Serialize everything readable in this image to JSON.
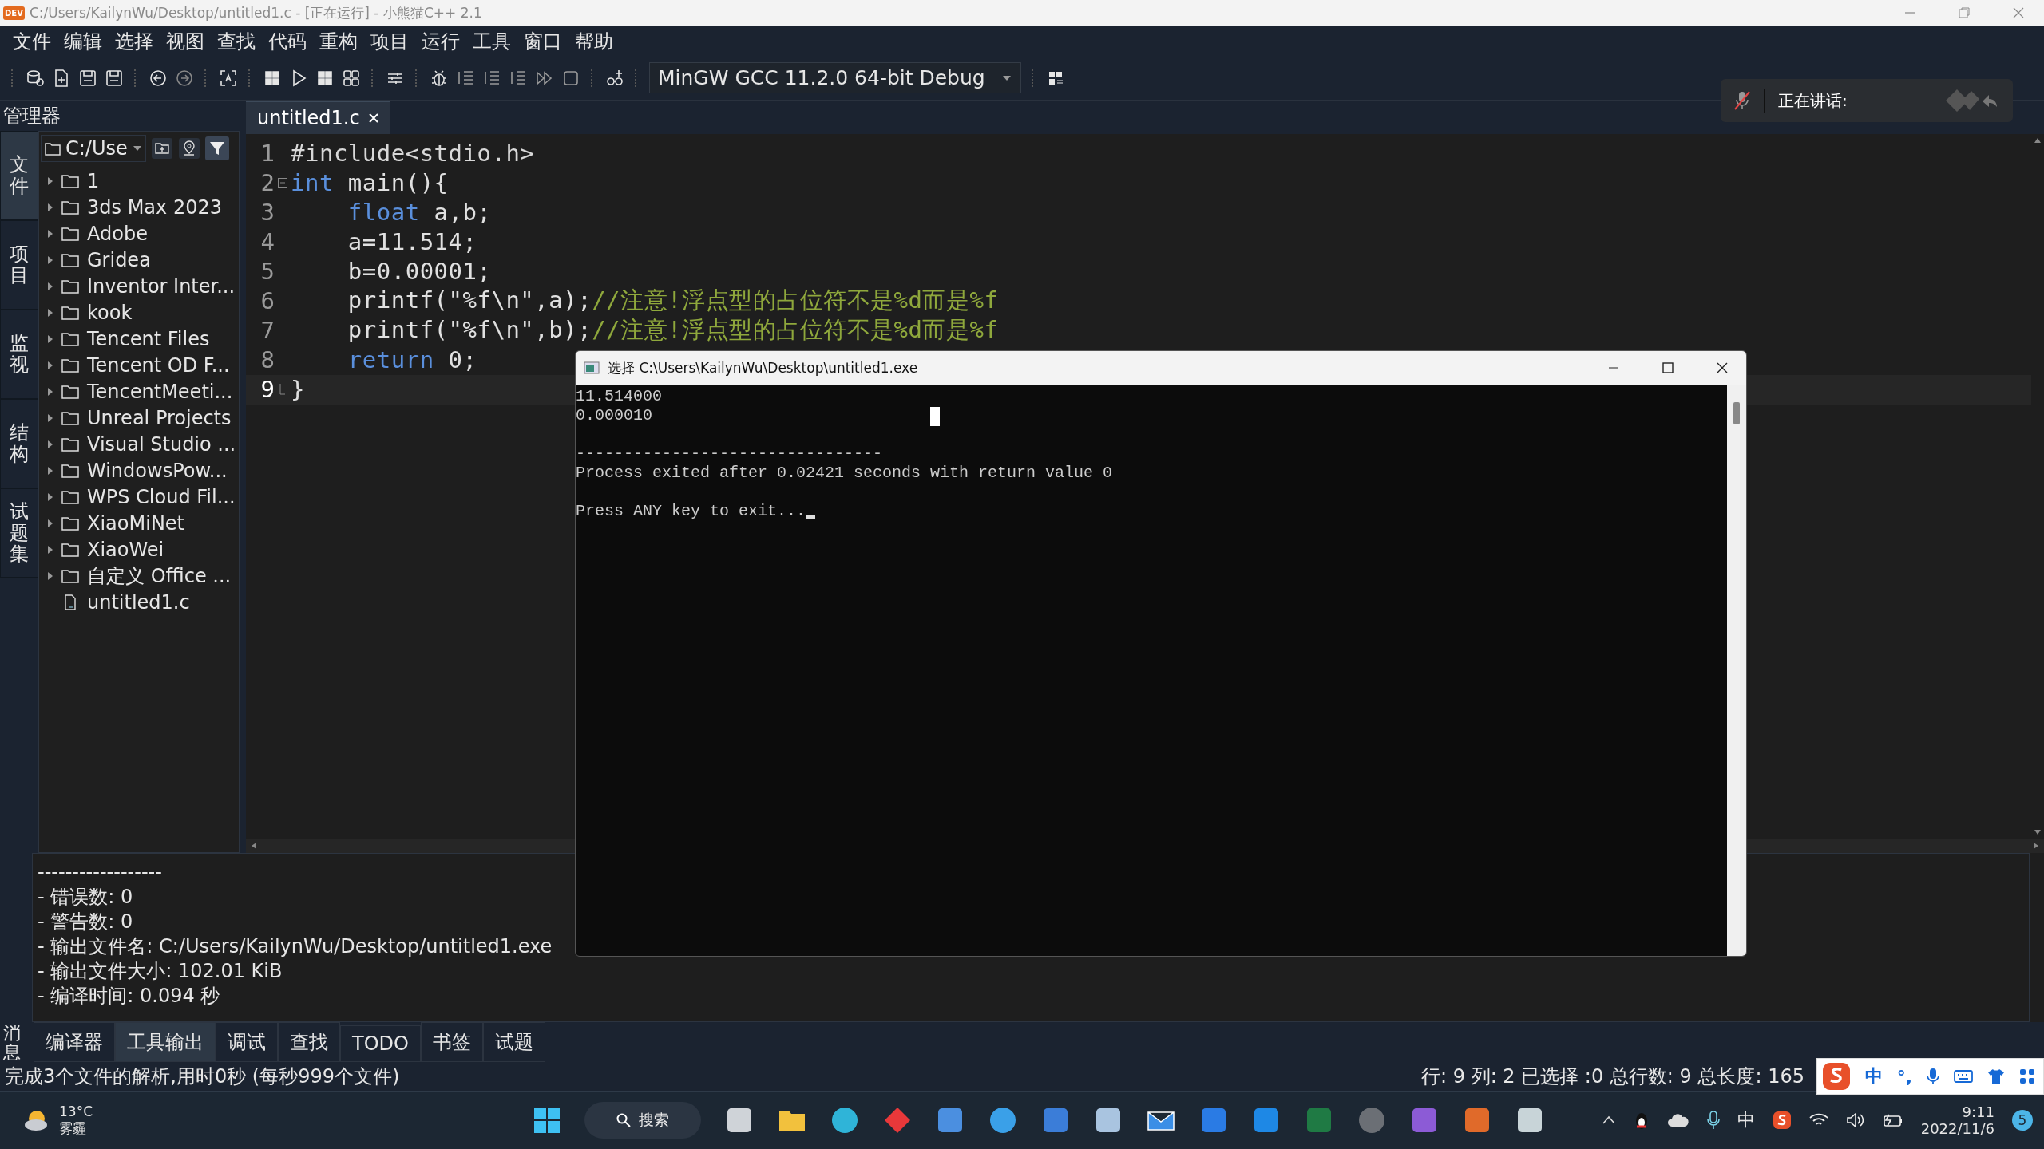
{
  "window": {
    "title": "C:/Users/KailynWu/Desktop/untitled1.c - [正在运行] - 小熊猫C++ 2.1",
    "logo": "DEV"
  },
  "menu": [
    "文件",
    "编辑",
    "选择",
    "视图",
    "查找",
    "代码",
    "重构",
    "项目",
    "运行",
    "工具",
    "窗口",
    "帮助"
  ],
  "toolbar": {
    "compiler": "MinGW GCC 11.2.0 64-bit Debug"
  },
  "manager": {
    "title": "管理器",
    "path": "C:/Use",
    "side_tabs": [
      {
        "label": "文件",
        "selected": true
      },
      {
        "label": "项目",
        "selected": false
      },
      {
        "label": "监视",
        "selected": false
      },
      {
        "label": "结构",
        "selected": false
      },
      {
        "label": "试题集",
        "selected": false
      }
    ],
    "tree": [
      {
        "kind": "folder",
        "label": "1"
      },
      {
        "kind": "folder",
        "label": "3ds Max 2023"
      },
      {
        "kind": "folder",
        "label": "Adobe"
      },
      {
        "kind": "folder",
        "label": "Gridea"
      },
      {
        "kind": "folder",
        "label": "Inventor Inter..."
      },
      {
        "kind": "folder",
        "label": "kook"
      },
      {
        "kind": "folder",
        "label": "Tencent Files"
      },
      {
        "kind": "folder",
        "label": "Tencent OD F..."
      },
      {
        "kind": "folder",
        "label": "TencentMeeti..."
      },
      {
        "kind": "folder",
        "label": "Unreal Projects"
      },
      {
        "kind": "folder",
        "label": "Visual Studio ..."
      },
      {
        "kind": "folder",
        "label": "WindowsPow..."
      },
      {
        "kind": "folder",
        "label": "WPS Cloud Fil..."
      },
      {
        "kind": "folder",
        "label": "XiaoMiNet"
      },
      {
        "kind": "folder",
        "label": "XiaoWei"
      },
      {
        "kind": "folder",
        "label": "自定义 Office ..."
      },
      {
        "kind": "file",
        "label": "untitled1.c"
      }
    ]
  },
  "editor": {
    "tabs": [
      {
        "label": "untitled1.c",
        "selected": true
      }
    ],
    "lines": [
      {
        "number": "1",
        "current": false,
        "fold_start": false,
        "fold_end": false,
        "tokens": [
          {
            "kind": "pre",
            "text": "#include<stdio.h>"
          }
        ]
      },
      {
        "number": "2",
        "current": false,
        "fold_start": true,
        "fold_end": false,
        "tokens": [
          {
            "kind": "keyword",
            "text": "int"
          },
          {
            "kind": "plain",
            "text": " main(){"
          }
        ]
      },
      {
        "number": "3",
        "current": false,
        "fold_start": false,
        "fold_end": false,
        "tokens": [
          {
            "kind": "keyword",
            "text": "    float"
          },
          {
            "kind": "plain",
            "text": " a,b;"
          }
        ]
      },
      {
        "number": "4",
        "current": false,
        "fold_start": false,
        "fold_end": false,
        "tokens": [
          {
            "kind": "plain",
            "text": "    a=11.514;"
          }
        ]
      },
      {
        "number": "5",
        "current": false,
        "fold_start": false,
        "fold_end": false,
        "tokens": [
          {
            "kind": "plain",
            "text": "    b=0.00001;"
          }
        ]
      },
      {
        "number": "6",
        "current": false,
        "fold_start": false,
        "fold_end": false,
        "tokens": [
          {
            "kind": "plain",
            "text": "    printf(\"%f\\n\",a);"
          },
          {
            "kind": "comment",
            "text": "//注意!浮点型的占位符不是%d而是%f"
          }
        ]
      },
      {
        "number": "7",
        "current": false,
        "fold_start": false,
        "fold_end": false,
        "tokens": [
          {
            "kind": "plain",
            "text": "    printf(\"%f\\n\",b);"
          },
          {
            "kind": "comment",
            "text": "//注意!浮点型的占位符不是%d而是%f"
          }
        ]
      },
      {
        "number": "8",
        "current": false,
        "fold_start": false,
        "fold_end": false,
        "tokens": [
          {
            "kind": "keyword",
            "text": "    return"
          },
          {
            "kind": "plain",
            "text": " 0;"
          }
        ]
      },
      {
        "number": "9",
        "current": true,
        "fold_start": false,
        "fold_end": true,
        "tokens": [
          {
            "kind": "plain",
            "text": "}"
          }
        ]
      }
    ]
  },
  "voice": {
    "label": "正在讲话:"
  },
  "console": {
    "title": "选择 C:\\Users\\KailynWu\\Desktop\\untitled1.exe",
    "output": [
      "11.514000",
      "0.000010"
    ],
    "separator": "--------------------------------",
    "exit_message": "Process exited after 0.02421 seconds with return value 0",
    "prompt": "Press ANY key to exit..."
  },
  "messages": {
    "lines": [
      "------------------",
      "- 错误数: 0",
      "- 警告数: 0",
      "- 输出文件名: C:/Users/KailynWu/Desktop/untitled1.exe",
      "- 输出文件大小: 102.01 KiB",
      "- 编译时间: 0.094 秒"
    ],
    "side_label": "消息",
    "tabs": [
      {
        "label": "编译器",
        "selected": false
      },
      {
        "label": "工具输出",
        "selected": true
      },
      {
        "label": "调试",
        "selected": false
      },
      {
        "label": "查找",
        "selected": false
      },
      {
        "label": "TODO",
        "selected": false
      },
      {
        "label": "书签",
        "selected": false
      },
      {
        "label": "试题",
        "selected": false
      }
    ]
  },
  "status_bar": {
    "left": "完成3个文件的解析,用时0秒 (每秒999个文件)",
    "right": "行: 9 列: 2 已选择 :0 总行数: 9 总长度: 165"
  },
  "ime": {
    "mode": "中",
    "punct": "°,"
  },
  "taskbar": {
    "temperature": "13°C",
    "weather": "雾霾",
    "search": "搜索",
    "tray_language": "中",
    "time": "9:11",
    "date": "2022/11/6",
    "notifications": "5"
  }
}
